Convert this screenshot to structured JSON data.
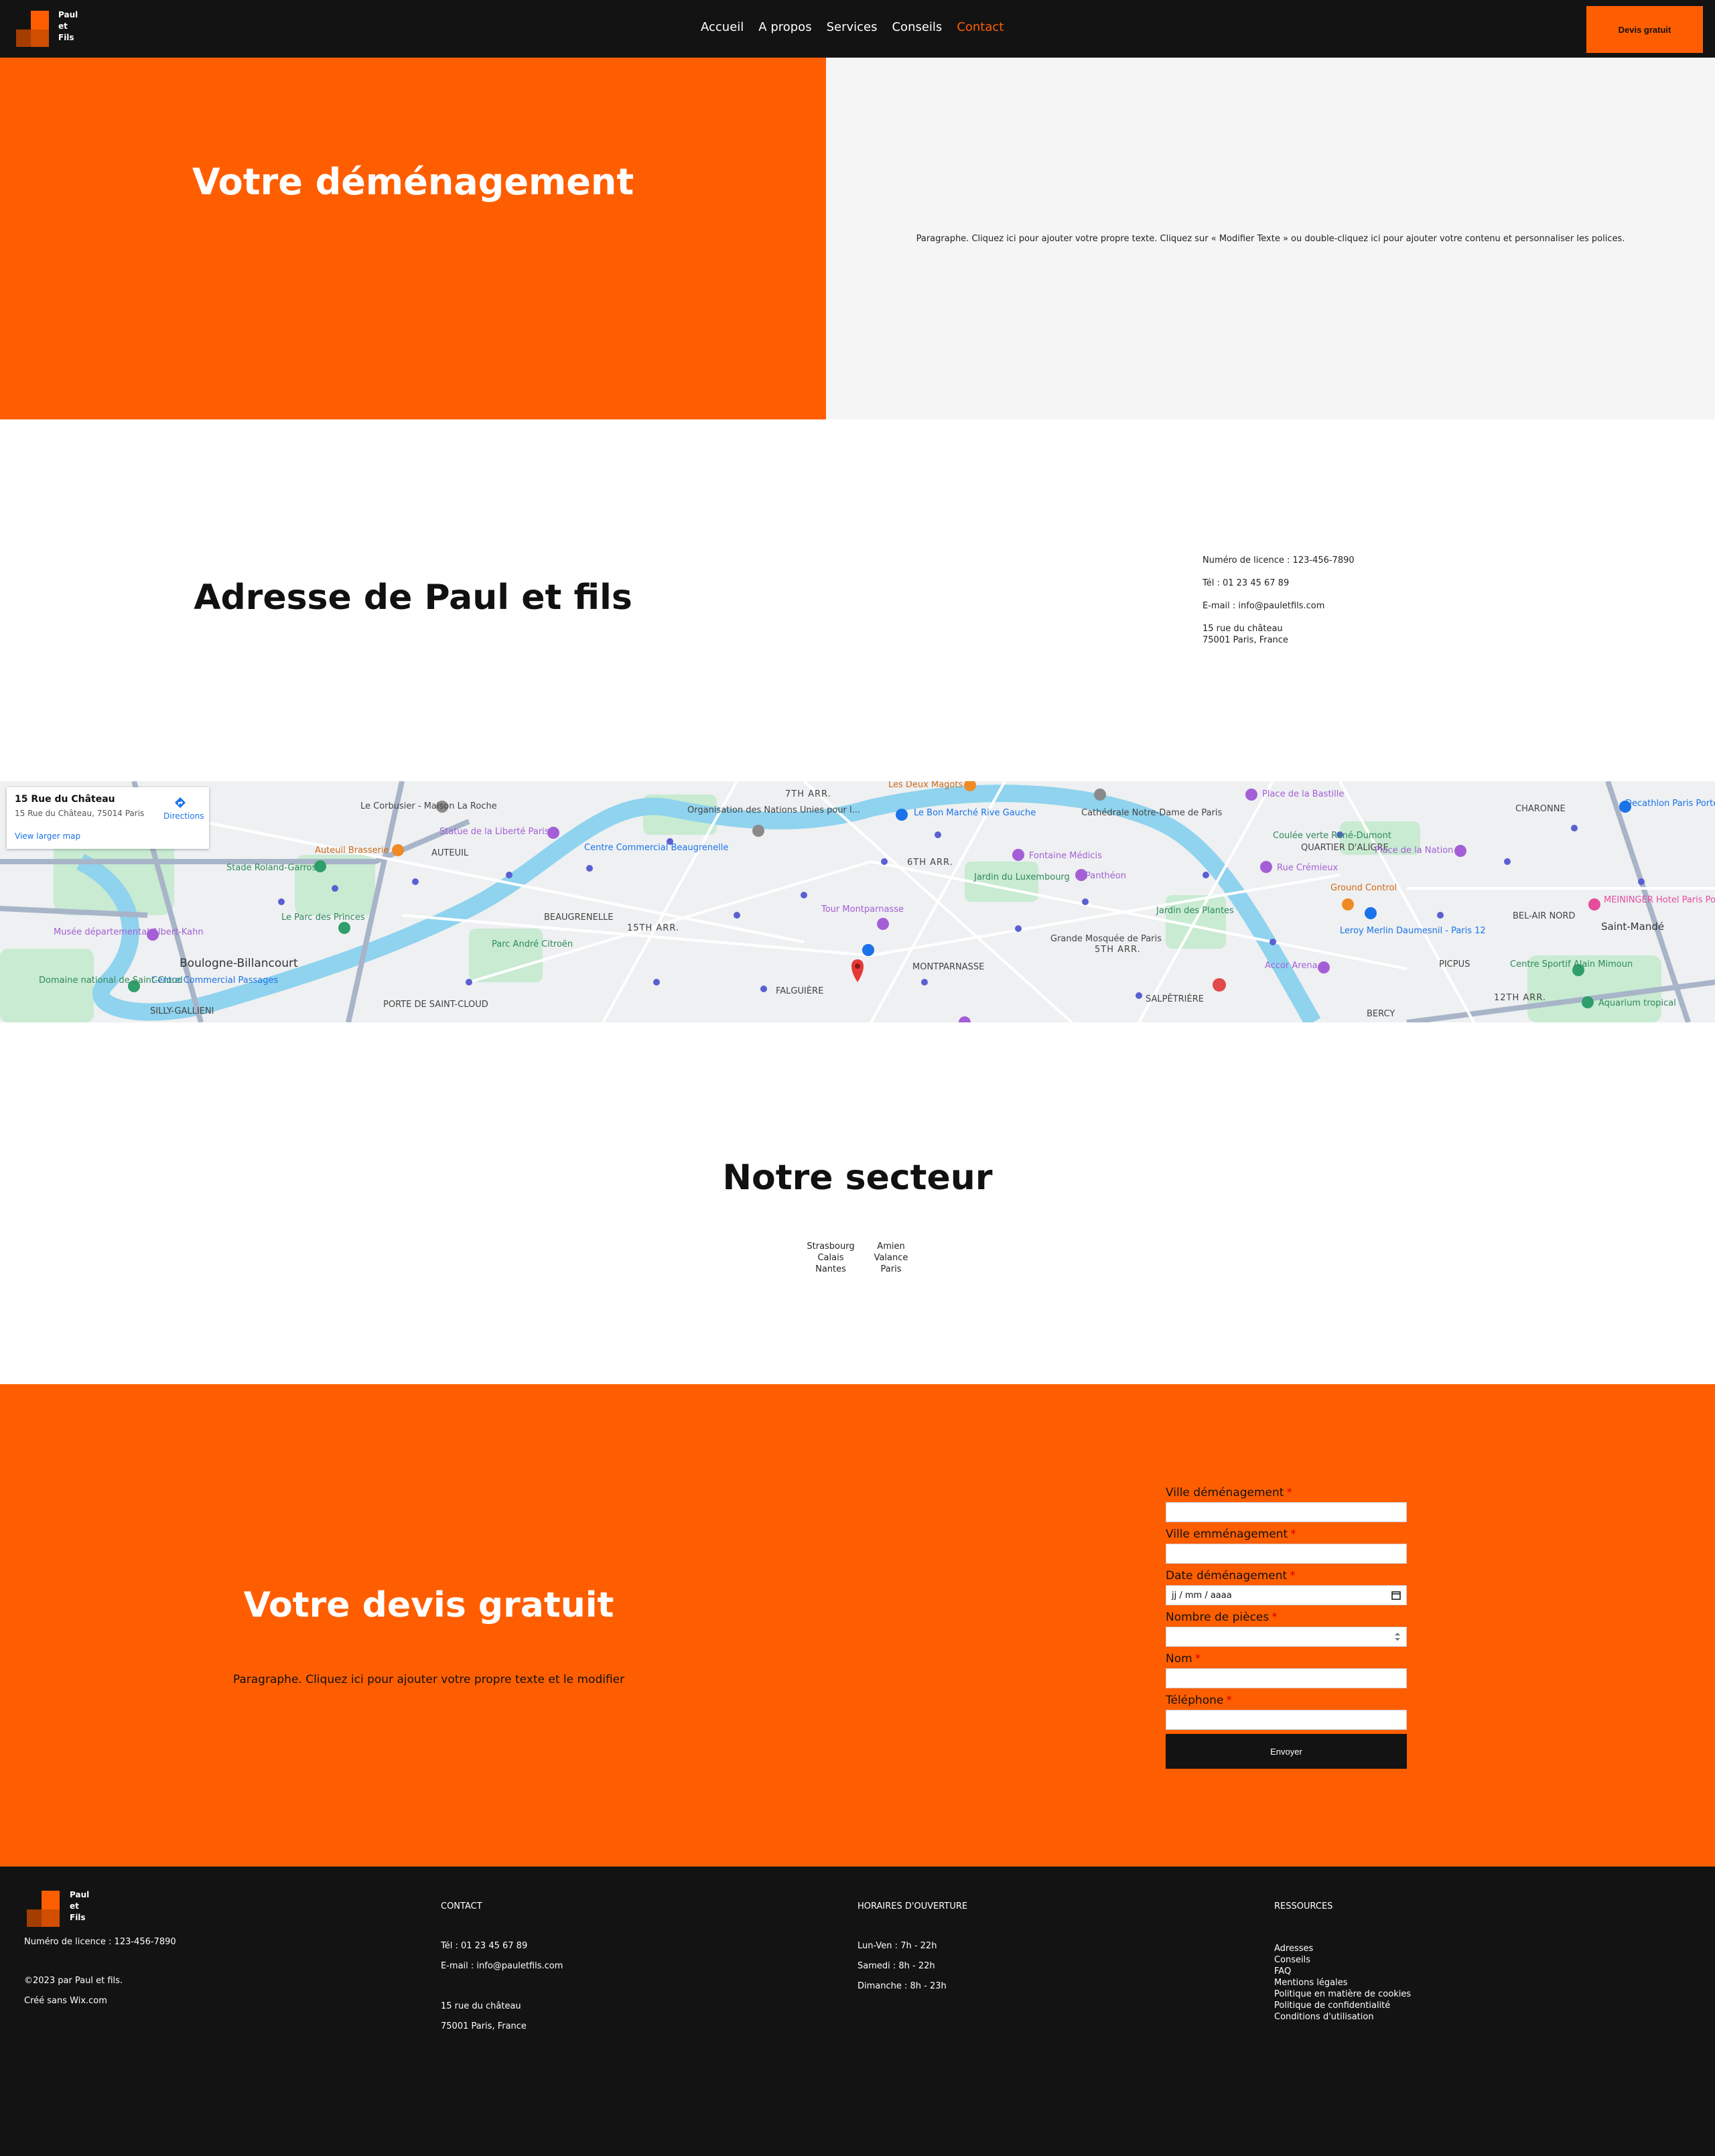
{
  "header": {
    "logo_lines": [
      "Paul",
      "et",
      "Fils"
    ],
    "nav": [
      "Accueil",
      "A propos",
      "Services",
      "Conseils",
      "Contact"
    ],
    "active_nav": "Contact",
    "cta": "Devis gratuit"
  },
  "hero": {
    "title": "Votre déménagement",
    "paragraph": "Paragraphe. Cliquez ici pour ajouter votre propre texte. Cliquez sur « Modifier Texte » ou double-cliquez ici pour ajouter votre contenu et personnaliser les polices."
  },
  "address": {
    "title": "Adresse de Paul et fils",
    "license": "Numéro de licence : 123-456-7890",
    "phone": "Tél : 01 23 45 67 89",
    "email": "E-mail : info@pauletfils.com",
    "street": "15 rue du château",
    "city": "75001 Paris, France"
  },
  "map": {
    "card_title": "15 Rue du Château",
    "card_address": "15 Rue du Château, 75014 Paris",
    "directions": "Directions",
    "larger_map": "View larger map",
    "labels": [
      "7TH ARR.",
      "6TH ARR.",
      "5TH ARR.",
      "15TH ARR.",
      "12TH ARR.",
      "Boulogne-Billancourt",
      "AUTEUIL",
      "BEAUGRENELLE",
      "FALGUIÈRE",
      "MONTPARNASSE",
      "SALPÊTRIÈRE",
      "BERCY",
      "PICPUS",
      "CHARONNE",
      "BEL-AIR NORD",
      "Saint-Mandé",
      "QUARTIER D'ALIGRE",
      "SILLY-GALLIENI",
      "PORTE DE SAINT-CLOUD",
      "Place de la Bastille",
      "Les Deux Magots",
      "Le Bon Marché Rive Gauche",
      "Jardin du Luxembourg",
      "Panthéon",
      "Tour Montparnasse",
      "Grande Mosquée de Paris",
      "Jardin des Plantes",
      "Accor Arena",
      "Statue de la Liberté Paris",
      "Centre Commercial Beaugrenelle",
      "Stade Roland-Garros",
      "Le Parc des Princes",
      "Musée départemental Albert-Kahn",
      "Centre Commercial Passages",
      "Parc André Citroën",
      "Fontaine Médicis",
      "Rue Crémieux",
      "Ground Control",
      "Leroy Merlin Daumesnil - Paris 12",
      "Decathlon Paris Porte De Montreuil",
      "MEININGER Hotel Paris Porte de Vincennes",
      "Centre Sportif Alain Mimoun",
      "Aquarium tropical",
      "Place de la Nation",
      "Coulée verte René-Dumont",
      "Cathédrale Notre-Dame de Paris",
      "Organisation des Nations Unies pour l...",
      "Le Corbusier - Maison La Roche",
      "Auteuil Brasserie",
      "Domaine national de Saint-Cloud"
    ]
  },
  "sector": {
    "title": "Notre secteur",
    "col1": [
      "Strasbourg",
      "Calais",
      "Nantes"
    ],
    "col2": [
      "Amien",
      "Valance",
      "Paris"
    ]
  },
  "quote": {
    "title": "Votre devis gratuit",
    "paragraph": "Paragraphe. Cliquez ici pour ajouter votre propre texte et le modifier",
    "fields": [
      "Ville déménagement",
      "Ville emménagement",
      "Date déménagement",
      "Nombre de pièces",
      "Nom",
      "Téléphone"
    ],
    "date_placeholder": "jj / mm / aaaa",
    "submit": "Envoyer"
  },
  "footer": {
    "license": "Numéro de licence : 123-456-7890",
    "copyright": "©2023 par Paul et fils.",
    "made_with": "Créé sans Wix.com",
    "contact_head": "CONTACT",
    "contact_phone": "Tél : 01 23 45 67 89",
    "contact_email": "E-mail : info@pauletfils.com",
    "contact_street": "15 rue du château",
    "contact_city": "75001 Paris, France",
    "hours_head": "HORAIRES D'OUVERTURE",
    "hours": [
      "Lun-Ven : 7h - 22h",
      "Samedi : 8h - 22h",
      "Dimanche : 8h - 23h"
    ],
    "resources_head": "RESSOURCES",
    "resources": [
      "Adresses",
      "Conseils",
      "FAQ",
      "Mentions légales",
      "Politique en matière de cookies",
      "Politique de confidentialité",
      "Conditions d'utilisation"
    ]
  },
  "colors": {
    "accent": "#ff5e00",
    "dark": "#131313",
    "light_bg": "#f5f5f5"
  }
}
